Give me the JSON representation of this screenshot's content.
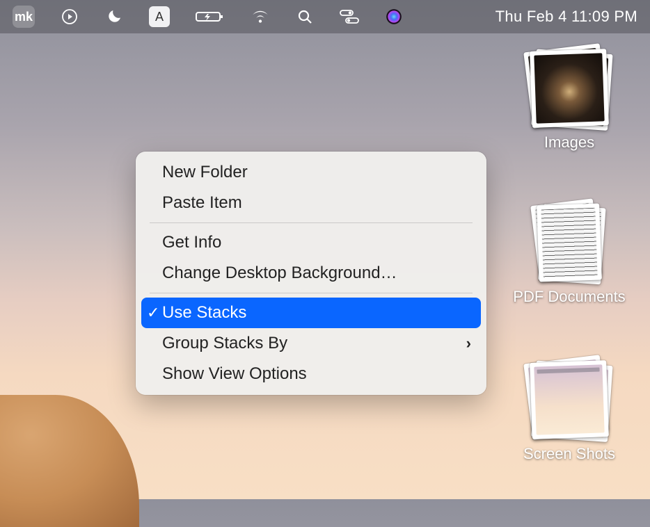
{
  "menubar": {
    "logo_text": "mk",
    "keyboard_letter": "A",
    "clock": "Thu Feb 4  11:09 PM",
    "icons": {
      "play": "play-icon",
      "moon": "moon-icon",
      "keyboard": "keyboard-input-icon",
      "battery": "battery-charging-icon",
      "wifi": "wifi-icon",
      "search": "search-icon",
      "control_center": "control-center-icon",
      "siri": "siri-icon"
    }
  },
  "desktop": {
    "stacks": [
      {
        "label": "Images",
        "kind": "images"
      },
      {
        "label": "PDF Documents",
        "kind": "pdf"
      },
      {
        "label": "Screen Shots",
        "kind": "screenshots"
      }
    ]
  },
  "context_menu": {
    "items": [
      {
        "label": "New Folder"
      },
      {
        "label": "Paste Item"
      },
      {
        "separator": true
      },
      {
        "label": "Get Info"
      },
      {
        "label": "Change Desktop Background…"
      },
      {
        "separator": true
      },
      {
        "label": "Use Stacks",
        "checked": true,
        "selected": true
      },
      {
        "label": "Group Stacks By",
        "submenu": true
      },
      {
        "label": "Show View Options"
      }
    ]
  }
}
